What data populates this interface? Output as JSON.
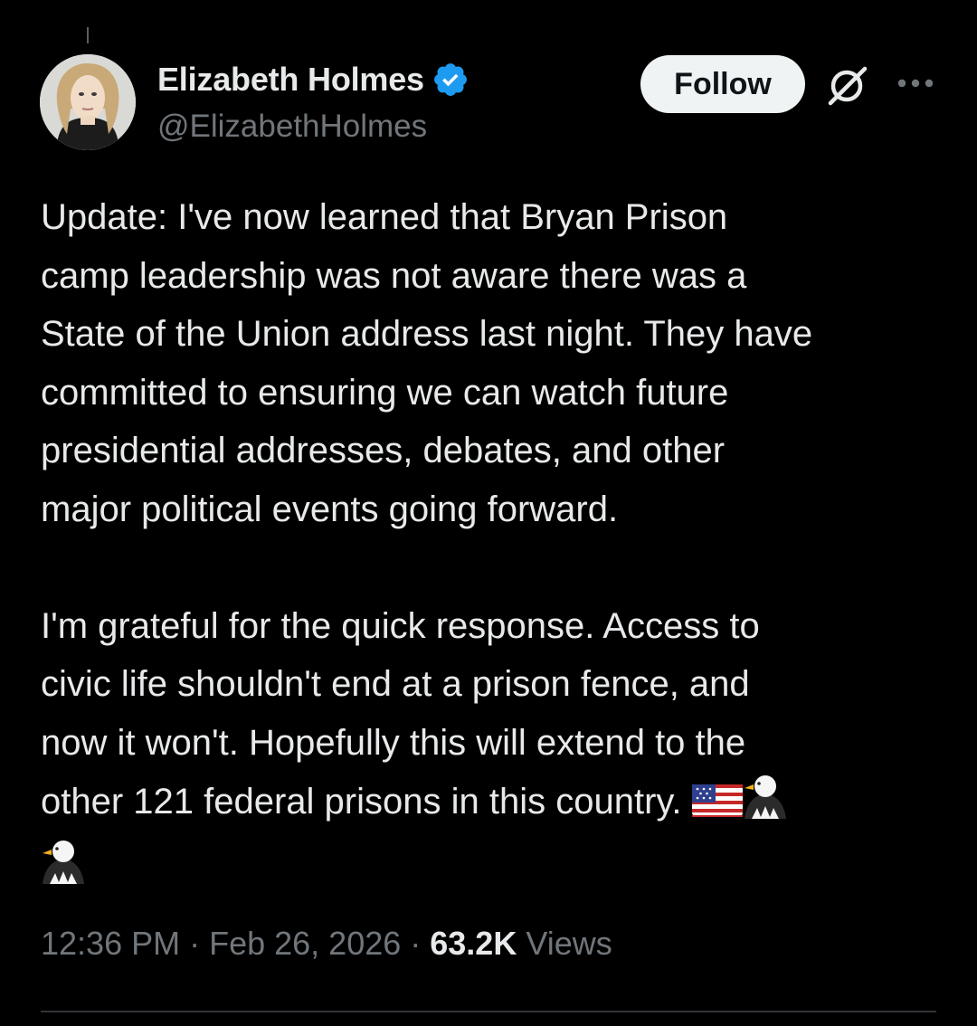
{
  "author": {
    "display_name": "Elizabeth Holmes",
    "handle": "@ElizabethHolmes",
    "verified": true,
    "verified_color": "#1d9bf0"
  },
  "actions": {
    "follow_label": "Follow",
    "grok_icon": "grok-slash-icon",
    "more_icon": "more-dots-icon"
  },
  "tweet": {
    "paragraph_1": "Update: I've now learned that Bryan Prison\ncamp leadership was not aware there was a\nState of the Union address last night. They have\ncommitted to ensuring we can watch future\npresidential addresses, debates, and other\nmajor political events going forward.",
    "paragraph_2": "I'm grateful for the quick response. Access to\ncivic life shouldn't end at a prison fence, and\nnow it won't. Hopefully this will extend to the\nother 121 federal prisons in this country. ",
    "emojis": [
      "us-flag-emoji",
      "eagle-emoji",
      "eagle-emoji"
    ]
  },
  "meta": {
    "time": "12:36 PM",
    "separator": " · ",
    "date": "Feb 26, 2026",
    "views_count": "63.2K",
    "views_label": " Views"
  },
  "colors": {
    "background": "#000000",
    "text_primary": "#e7e9ea",
    "text_secondary": "#71767b",
    "divider": "#2f3336",
    "follow_bg": "#eff3f4"
  }
}
